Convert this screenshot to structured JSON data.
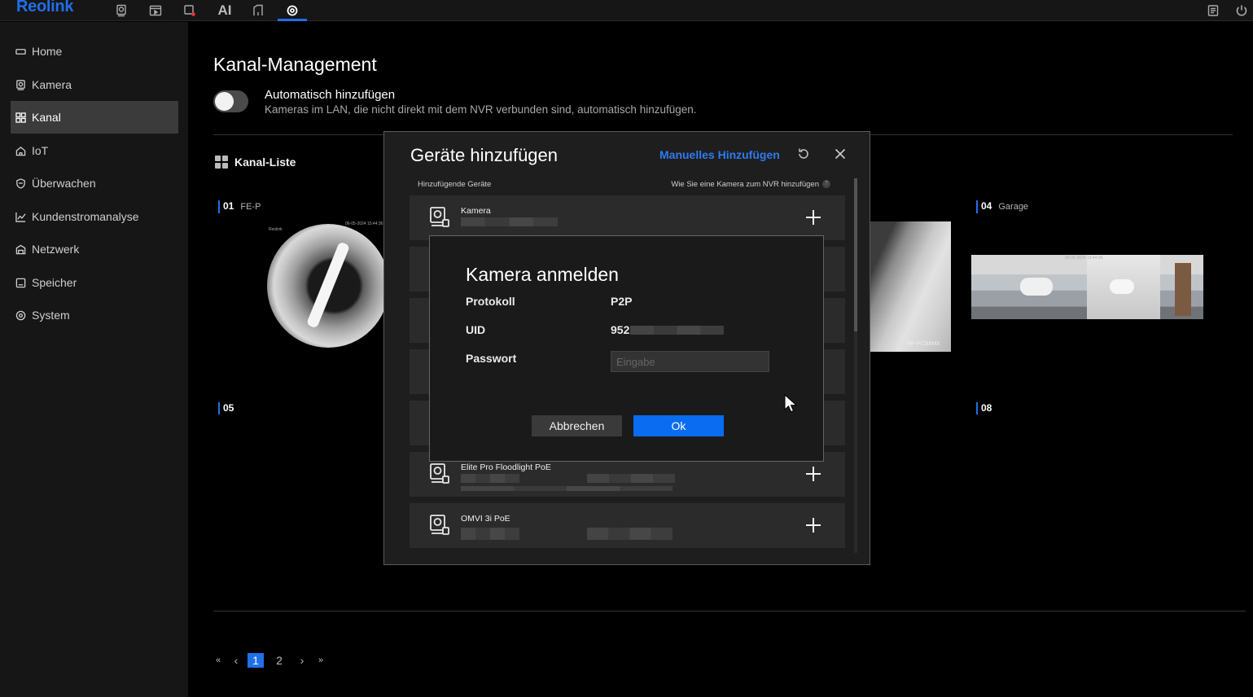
{
  "app": {
    "logo": "Reolink",
    "top_icons": [
      "camera-icon",
      "playback-icon",
      "alarm-icon",
      "ai-icon",
      "tag-icon",
      "settings-icon",
      "notes-icon",
      "power-icon"
    ],
    "ai_label": "AI",
    "accent_color": "#1f6fe8"
  },
  "sidebar": {
    "items": [
      {
        "label": "Home",
        "icon": "home-icon"
      },
      {
        "label": "Kamera",
        "icon": "camera-icon"
      },
      {
        "label": "Kanal",
        "icon": "grid-icon",
        "active": true
      },
      {
        "label": "IoT",
        "icon": "house-icon"
      },
      {
        "label": "Überwachen",
        "icon": "shield-icon"
      },
      {
        "label": "Kundenstromanalyse",
        "icon": "chart-icon"
      },
      {
        "label": "Netzwerk",
        "icon": "network-icon"
      },
      {
        "label": "Speicher",
        "icon": "storage-icon"
      },
      {
        "label": "System",
        "icon": "gear-icon"
      }
    ]
  },
  "main": {
    "title": "Kanal-Management",
    "auto_add": {
      "title": "Automatisch hinzufügen",
      "description": "Kameras im LAN, die nicht direkt mit dem NVR verbunden sind, automatisch hinzufügen.",
      "enabled": false
    },
    "channel_list_title": "Kanal-Liste",
    "channels": [
      {
        "num": "01",
        "name": "FE-P"
      },
      {
        "num": "04",
        "name": "Garage"
      },
      {
        "num": "05",
        "name": ""
      },
      {
        "num": "08",
        "name": ""
      }
    ],
    "thumb_labels": {
      "fe_brand": "Reolink",
      "fe_time": "06-05-2024 15:44:36",
      "cam_tag": "RP-PCB8MX",
      "garage_time": "06-05-2024 15:44:36",
      "garage_tag": "RL"
    },
    "pagination": {
      "first": "«",
      "prev": "‹",
      "pages": [
        "1",
        "2"
      ],
      "current": "1",
      "next": "›",
      "last": "»"
    }
  },
  "add_dialog": {
    "title": "Geräte hinzufügen",
    "manual_link": "Manuelles Hinzufügen",
    "header_left": "Hinzufügende Geräte",
    "header_right": "Wie Sie eine Kamera zum NVR hinzufügen",
    "help": "?",
    "devices": [
      {
        "name": "Kamera"
      },
      {
        "name": ""
      },
      {
        "name": ""
      },
      {
        "name": ""
      },
      {
        "name": ""
      },
      {
        "name": "Elite Pro Floodlight PoE"
      },
      {
        "name": "OMVI 3i PoE"
      }
    ]
  },
  "login_dialog": {
    "title": "Kamera anmelden",
    "protocol_label": "Protokoll",
    "protocol_value": "P2P",
    "uid_label": "UID",
    "uid_value": "952",
    "password_label": "Passwort",
    "password_placeholder": "Eingabe",
    "cancel_label": "Abbrechen",
    "ok_label": "Ok"
  }
}
